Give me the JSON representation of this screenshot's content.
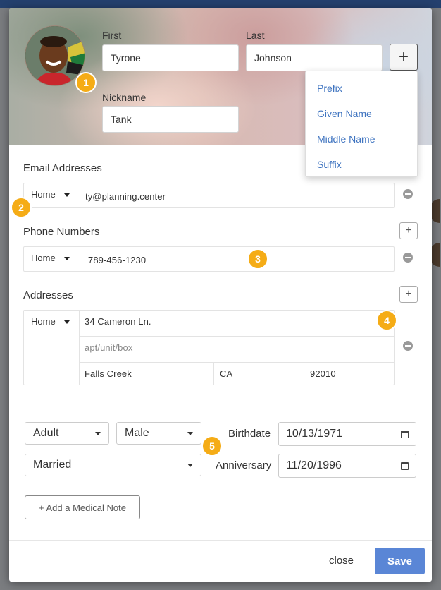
{
  "header": {
    "first_label": "First",
    "first_value": "Tyrone",
    "last_label": "Last",
    "last_value": "Johnson",
    "nickname_label": "Nickname",
    "nickname_value": "Tank",
    "add_name_part_label": "+"
  },
  "name_parts_menu": [
    "Prefix",
    "Given Name",
    "Middle Name",
    "Suffix"
  ],
  "badges": [
    "1",
    "2",
    "3",
    "4",
    "5"
  ],
  "email": {
    "title": "Email Addresses",
    "type": "Home",
    "value": "ty@planning.center"
  },
  "phone": {
    "title": "Phone Numbers",
    "type": "Home",
    "value": "789-456-1230",
    "add_label": "+"
  },
  "address": {
    "title": "Addresses",
    "type": "Home",
    "street": "34 Cameron Ln.",
    "line2_placeholder": "apt/unit/box",
    "city": "Falls Creek",
    "state": "CA",
    "zip": "92010",
    "add_label": "+"
  },
  "details": {
    "age_group": "Adult",
    "gender": "Male",
    "marital_status": "Married",
    "birthdate_label": "Birthdate",
    "birthdate": "10/13/1971",
    "anniversary_label": "Anniversary",
    "anniversary": "11/20/1996",
    "medical_note_label": "+ Add a Medical Note"
  },
  "footer": {
    "close_label": "close",
    "save_label": "Save"
  },
  "colors": {
    "accent": "#5a86d6",
    "badge": "#f5ac16",
    "link": "#3f74c0"
  }
}
